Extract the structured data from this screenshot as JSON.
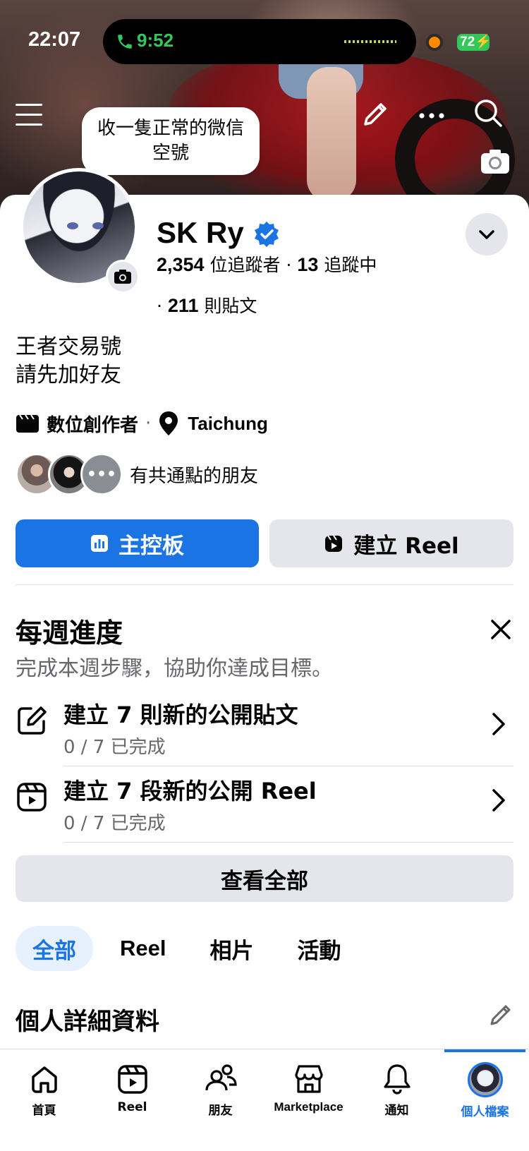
{
  "status_bar": {
    "time": "22:07",
    "call_time": "9:52",
    "battery": "72"
  },
  "cover": {
    "bubble_text_line1": "收一隻正常的微信",
    "bubble_text_line2": "空號"
  },
  "profile": {
    "name": "SK Ry",
    "followers_count": "2,354",
    "followers_label": "位追蹤者",
    "following_count": "13",
    "following_label": "追蹤中",
    "posts_count": "211",
    "posts_label": "則貼文",
    "bio_line1": "王者交易號",
    "bio_line2": "請先加好友",
    "category": "數位創作者",
    "location": "Taichung",
    "mutual_friends_label": "有共通點的朋友"
  },
  "actions": {
    "dashboard": "主控板",
    "create_reel": "建立 Reel"
  },
  "weekly": {
    "title": "每週進度",
    "subtitle": "完成本週步驟，協助你達成目標。",
    "tasks": [
      {
        "title": "建立 7 則新的公開貼文",
        "progress": "0 / 7 已完成",
        "icon": "edit-square-icon"
      },
      {
        "title": "建立 7 段新的公開 Reel",
        "progress": "0 / 7 已完成",
        "icon": "reel-icon"
      }
    ],
    "see_all": "查看全部"
  },
  "tabs": [
    {
      "label": "全部",
      "active": true
    },
    {
      "label": "Reel",
      "active": false
    },
    {
      "label": "相片",
      "active": false
    },
    {
      "label": "活動",
      "active": false
    }
  ],
  "details": {
    "title": "個人詳細資料"
  },
  "bottom_nav": [
    {
      "label": "首頁",
      "icon": "home-icon"
    },
    {
      "label": "Reel",
      "icon": "reel-icon"
    },
    {
      "label": "朋友",
      "icon": "friends-icon"
    },
    {
      "label": "Marketplace",
      "icon": "marketplace-icon"
    },
    {
      "label": "通知",
      "icon": "bell-icon"
    },
    {
      "label": "個人檔案",
      "icon": "profile-avatar",
      "active": true
    }
  ],
  "colors": {
    "accent": "#1b74e4",
    "secondary_button": "#e4e6eb",
    "muted_text": "#65676b"
  }
}
